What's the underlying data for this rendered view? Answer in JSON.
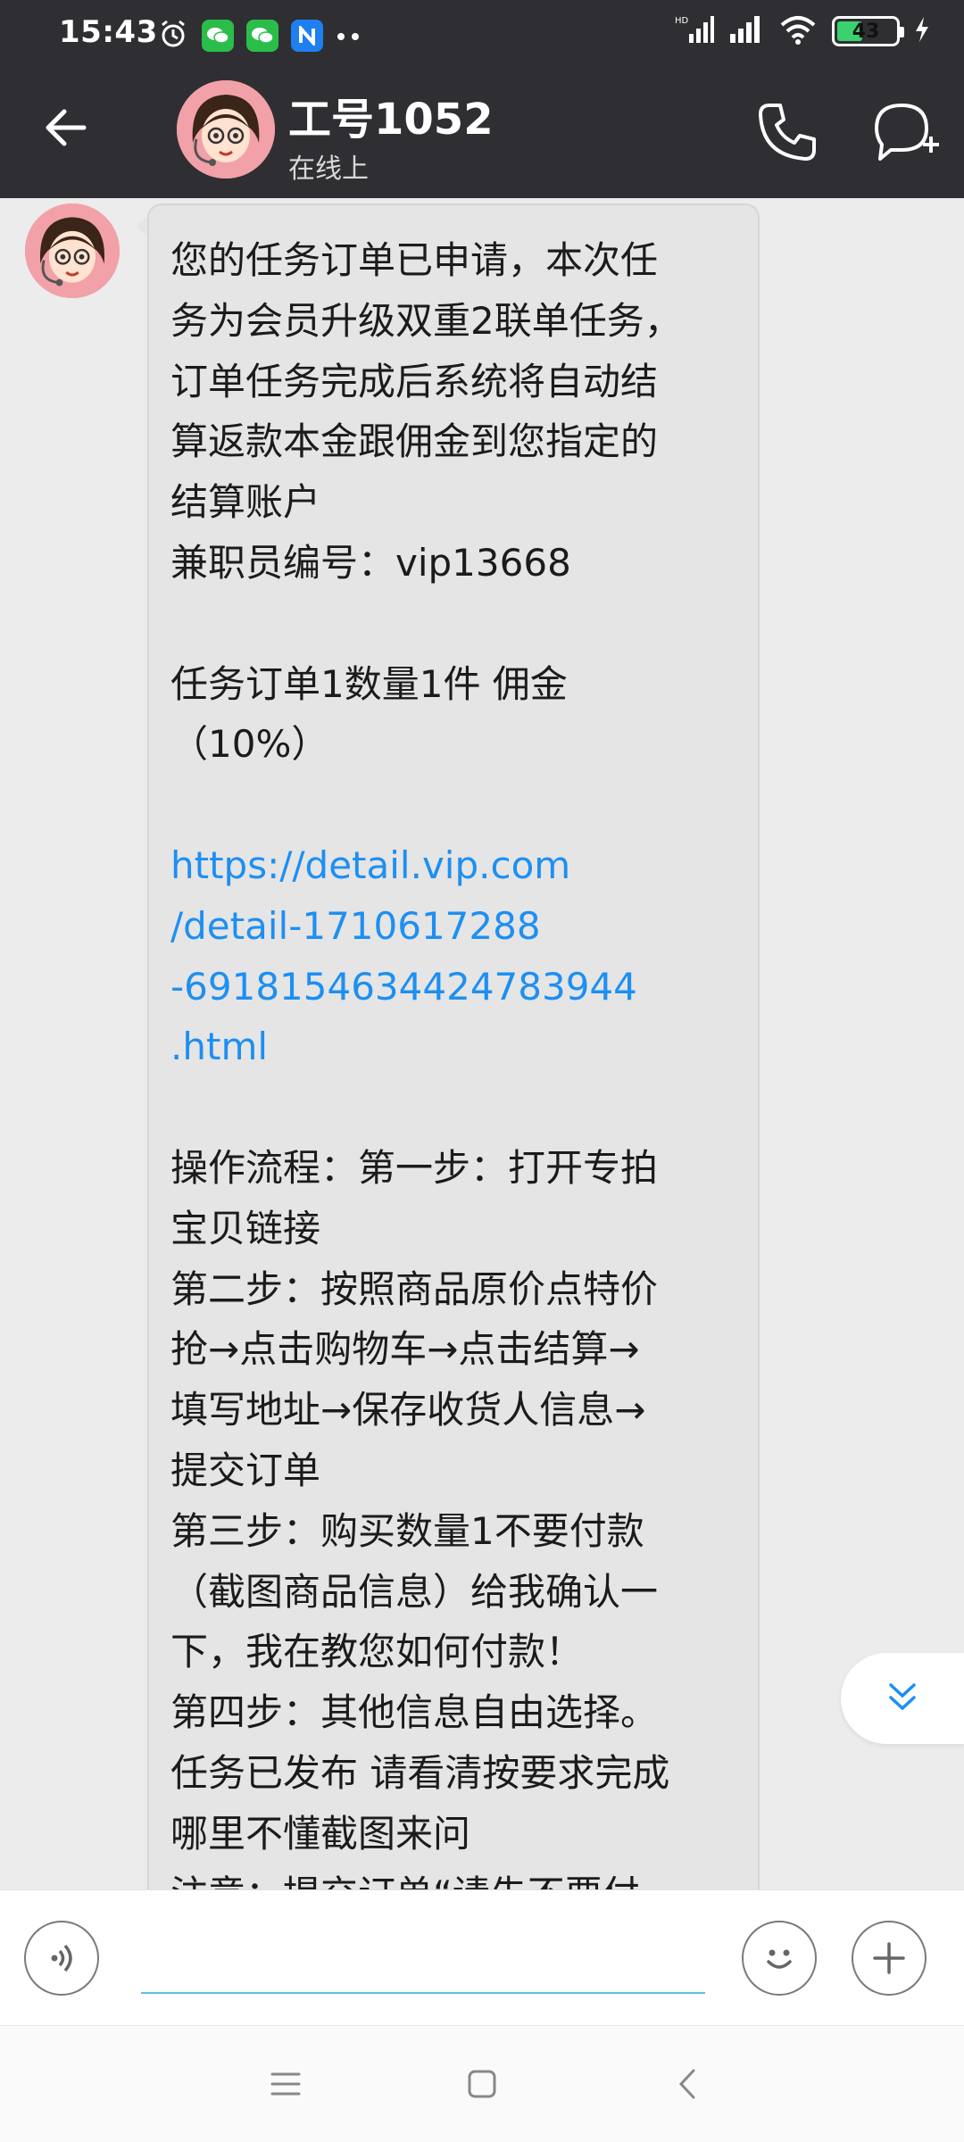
{
  "status_bar": {
    "time": "15:43",
    "battery_level": "43",
    "battery_fraction": 0.43,
    "left_icons": [
      "alarm-icon",
      "wechat-icon",
      "wechat-icon",
      "n-app-icon",
      "more-dots-icon"
    ],
    "right_icons": [
      "hd-signal-icon",
      "signal-icon",
      "wifi-icon",
      "battery-icon",
      "charging-icon"
    ]
  },
  "header": {
    "contact_name": "工号1052",
    "contact_status": "在线上",
    "back_icon": "back-arrow-icon",
    "call_icon": "phone-icon",
    "chat_add_icon": "chat-add-icon"
  },
  "message": {
    "lines": [
      {
        "text": "您的任务订单已申请，本次任"
      },
      {
        "text": "务为会员升级双重2联单任务，"
      },
      {
        "text": "订单任务完成后系统将自动结"
      },
      {
        "text": "算返款本金跟佣金到您指定的"
      },
      {
        "text": "结算账户"
      },
      {
        "text": "兼职员编号：vip13668"
      },
      {
        "text": ""
      },
      {
        "text": "任务订单1数量1件 佣金"
      },
      {
        "text": "（10%）"
      },
      {
        "text": ""
      },
      {
        "text": "https://detail.vip.com",
        "link": true
      },
      {
        "text": "/detail-1710617288",
        "link": true
      },
      {
        "text": "-6918154634424783944",
        "link": true
      },
      {
        "text": ".html",
        "link": true
      },
      {
        "text": ""
      },
      {
        "text": "操作流程：第一步：打开专拍"
      },
      {
        "text": "宝贝链接"
      },
      {
        "text": "第二步：按照商品原价点特价"
      },
      {
        "text": "抢→点击购物车→点击结算→"
      },
      {
        "text": "填写地址→保存收货人信息→"
      },
      {
        "text": "提交订单"
      },
      {
        "text": "第三步：购买数量1不要付款"
      },
      {
        "text": "（截图商品信息）给我确认一"
      },
      {
        "text": "下，我在教您如何付款！"
      },
      {
        "text": "第四步：其他信息自由选择。"
      },
      {
        "text": "任务已发布 请看清按要求完成"
      },
      {
        "text": "哪里不懂截图来问"
      },
      {
        "text": "注意：提交订单“请先不要付"
      }
    ]
  },
  "colors": {
    "header_bg": "#2f2f33",
    "chat_bg": "#ececec",
    "bubble_bg": "#e5e5e5",
    "link": "#1d8ff2",
    "input_underline": "#5bc1d8",
    "battery_green": "#3ad16e"
  },
  "input_bar": {
    "message_value": "",
    "voice_icon": "voice-icon",
    "emoji_icon": "emoji-icon",
    "plus_icon": "plus-icon"
  },
  "nav_bar": {
    "icons": [
      "menu-icon",
      "home-icon",
      "back-icon"
    ]
  }
}
